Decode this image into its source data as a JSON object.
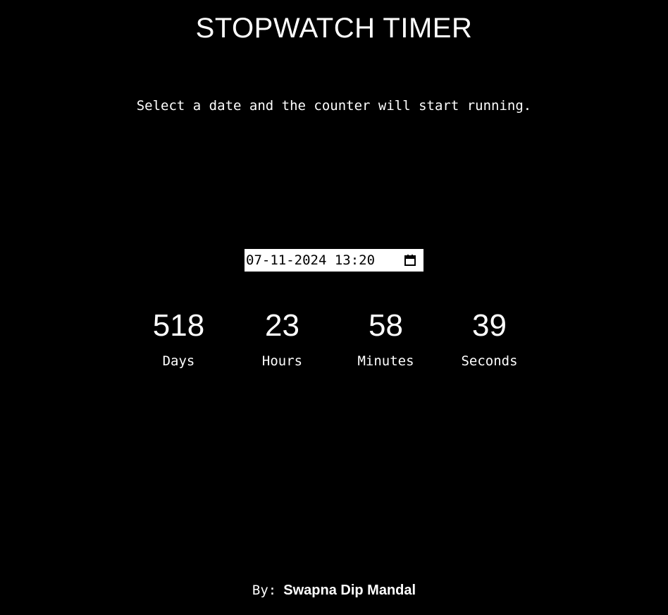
{
  "header": {
    "title": "STOPWATCH TIMER",
    "subtitle": "Select a date and the counter will start running."
  },
  "date_input": {
    "value": "07-11-2024 13:20",
    "icon": "calendar-icon"
  },
  "counters": [
    {
      "value": "518",
      "label": "Days"
    },
    {
      "value": "23",
      "label": "Hours"
    },
    {
      "value": "58",
      "label": "Minutes"
    },
    {
      "value": "39",
      "label": "Seconds"
    }
  ],
  "footer": {
    "by_label": "By:",
    "author": "Swapna Dip Mandal"
  },
  "colors": {
    "background": "#000000",
    "text": "#ffffff",
    "input_background": "#ffffff",
    "input_text": "#000000"
  }
}
